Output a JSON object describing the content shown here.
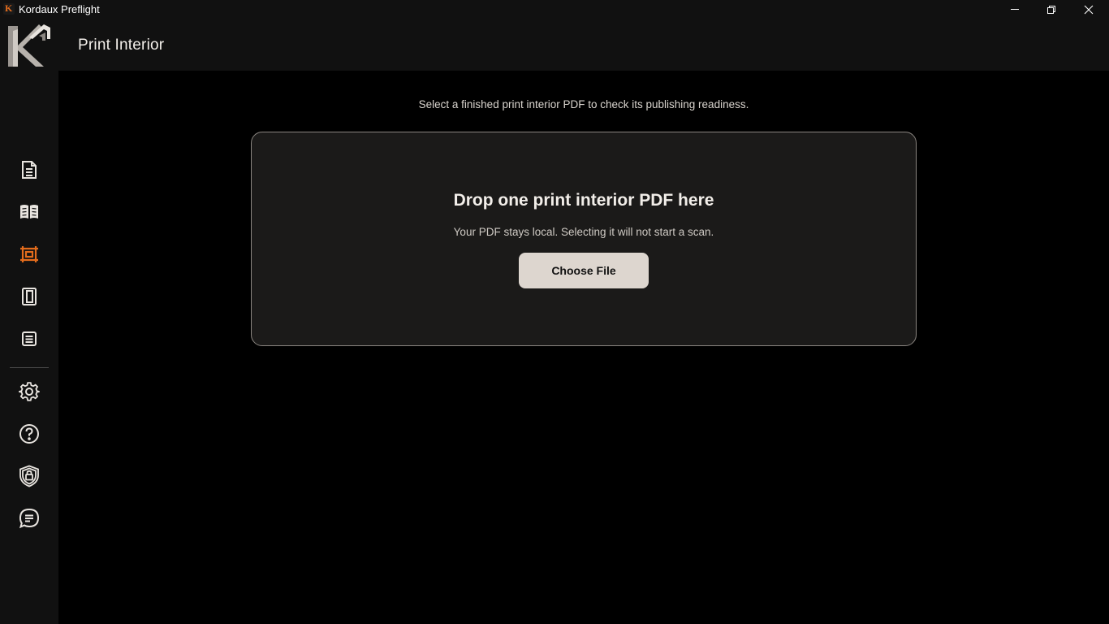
{
  "window": {
    "title": "Kordaux Preflight",
    "app_icon_letter": "K"
  },
  "header": {
    "title": "Print Interior"
  },
  "sidebar": {
    "items": [
      {
        "icon": "document-icon",
        "active": false
      },
      {
        "icon": "open-book-icon",
        "active": false
      },
      {
        "icon": "print-interior-icon",
        "active": true
      },
      {
        "icon": "book-cover-icon",
        "active": false
      },
      {
        "icon": "notes-icon",
        "active": false
      },
      {
        "icon": "gear-icon",
        "active": false
      },
      {
        "icon": "help-icon",
        "active": false
      },
      {
        "icon": "privacy-shield-icon",
        "active": false
      },
      {
        "icon": "feedback-chat-icon",
        "active": false
      }
    ]
  },
  "main": {
    "instruction": "Select a finished print interior PDF to check its publishing readiness.",
    "dropzone": {
      "title": "Drop one print interior PDF here",
      "subtitle": "Your PDF stays local. Selecting it will not start a scan.",
      "button_label": "Choose File"
    }
  },
  "colors": {
    "background": "#000000",
    "chrome": "#111111",
    "panel": "#1b1a19",
    "accent": "#e36c1c",
    "button": "#ddd6cf",
    "icon": "#e8e4df"
  }
}
